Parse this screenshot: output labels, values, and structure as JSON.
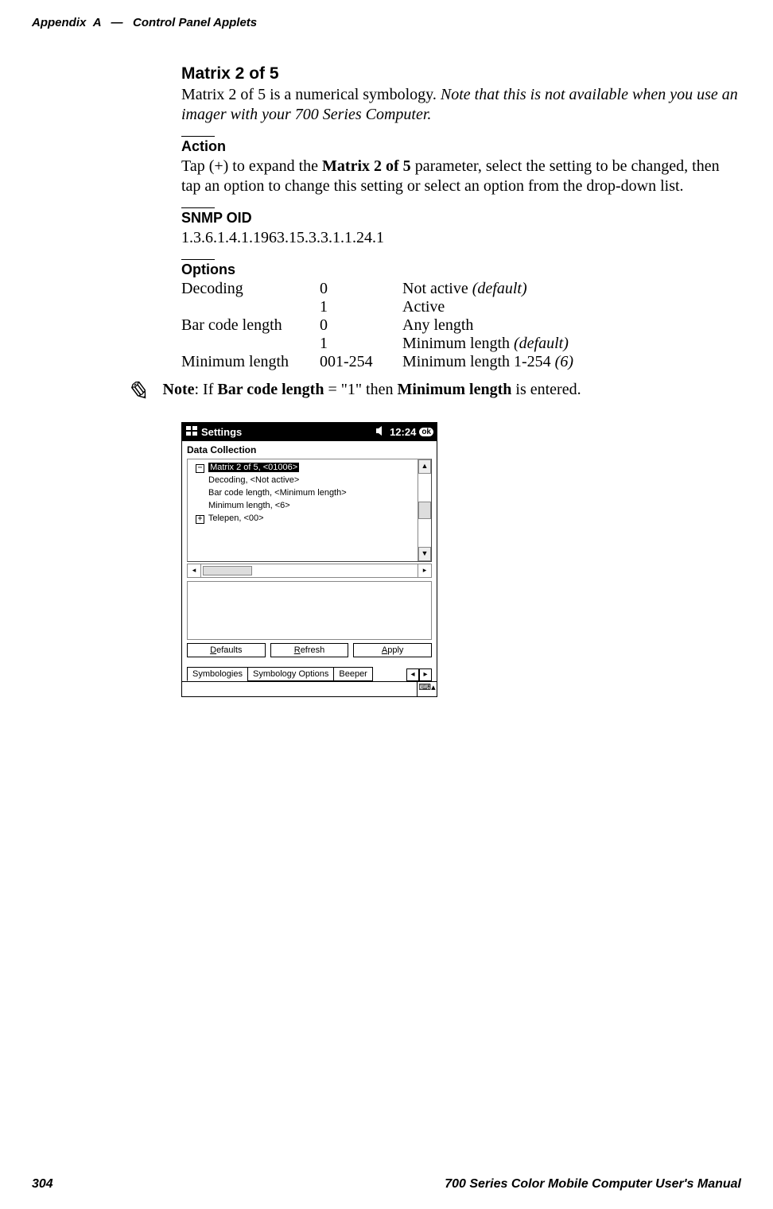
{
  "header": {
    "appendix": "Appendix",
    "letter": "A",
    "dash": "—",
    "title": "Control Panel Applets"
  },
  "section": {
    "title": "Matrix 2 of 5",
    "intro_plain": "Matrix 2 of 5 is a numerical symbology. ",
    "intro_italic": "Note that this is not available when you use an imager with your 700 Series Computer."
  },
  "action": {
    "heading": "Action",
    "pre": "Tap (+) to expand the ",
    "bold": "Matrix 2 of 5",
    "post": " parameter, select the setting to be changed, then tap an option to change this setting or select an option from the drop-down list."
  },
  "snmp": {
    "heading": "SNMP OID",
    "value": "1.3.6.1.4.1.1963.15.3.3.1.1.24.1"
  },
  "options": {
    "heading": "Options",
    "rows": [
      {
        "c1": "Decoding",
        "c2": "0",
        "c3": "Not active ",
        "c3_it": "(default)"
      },
      {
        "c1": "",
        "c2": "1",
        "c3": "Active",
        "c3_it": ""
      },
      {
        "c1": "Bar code length",
        "c2": "0",
        "c3": "Any length",
        "c3_it": ""
      },
      {
        "c1": "",
        "c2": "1",
        "c3": "Minimum length ",
        "c3_it": "(default)"
      },
      {
        "c1": "Minimum length",
        "c2": "001-254",
        "c3": "Minimum length 1-254 ",
        "c3_it": "(6)"
      }
    ]
  },
  "note": {
    "prefix_bold": "Note",
    "mid1": ": If ",
    "bold1": "Bar code length",
    "mid2": " = \"1\" then ",
    "bold2": "Minimum length",
    "mid3": " is entered."
  },
  "scr": {
    "title": "Settings",
    "time": "12:24",
    "ok": "ok",
    "subtitle": "Data Collection",
    "tree": {
      "selected": "Matrix 2 of 5, <01006>",
      "child1": "Decoding, <Not active>",
      "child2": "Bar code length, <Minimum length>",
      "child3": "Minimum length, <6>",
      "next": "Telepen, <00>"
    },
    "buttons": {
      "defaults": "Defaults",
      "refresh": "Refresh",
      "apply": "Apply"
    },
    "tabs": {
      "t1": "Symbologies",
      "t2": "Symbology Options",
      "t3": "Beeper"
    }
  },
  "footer": {
    "page": "304",
    "manual": "700 Series Color Mobile Computer User's Manual"
  }
}
